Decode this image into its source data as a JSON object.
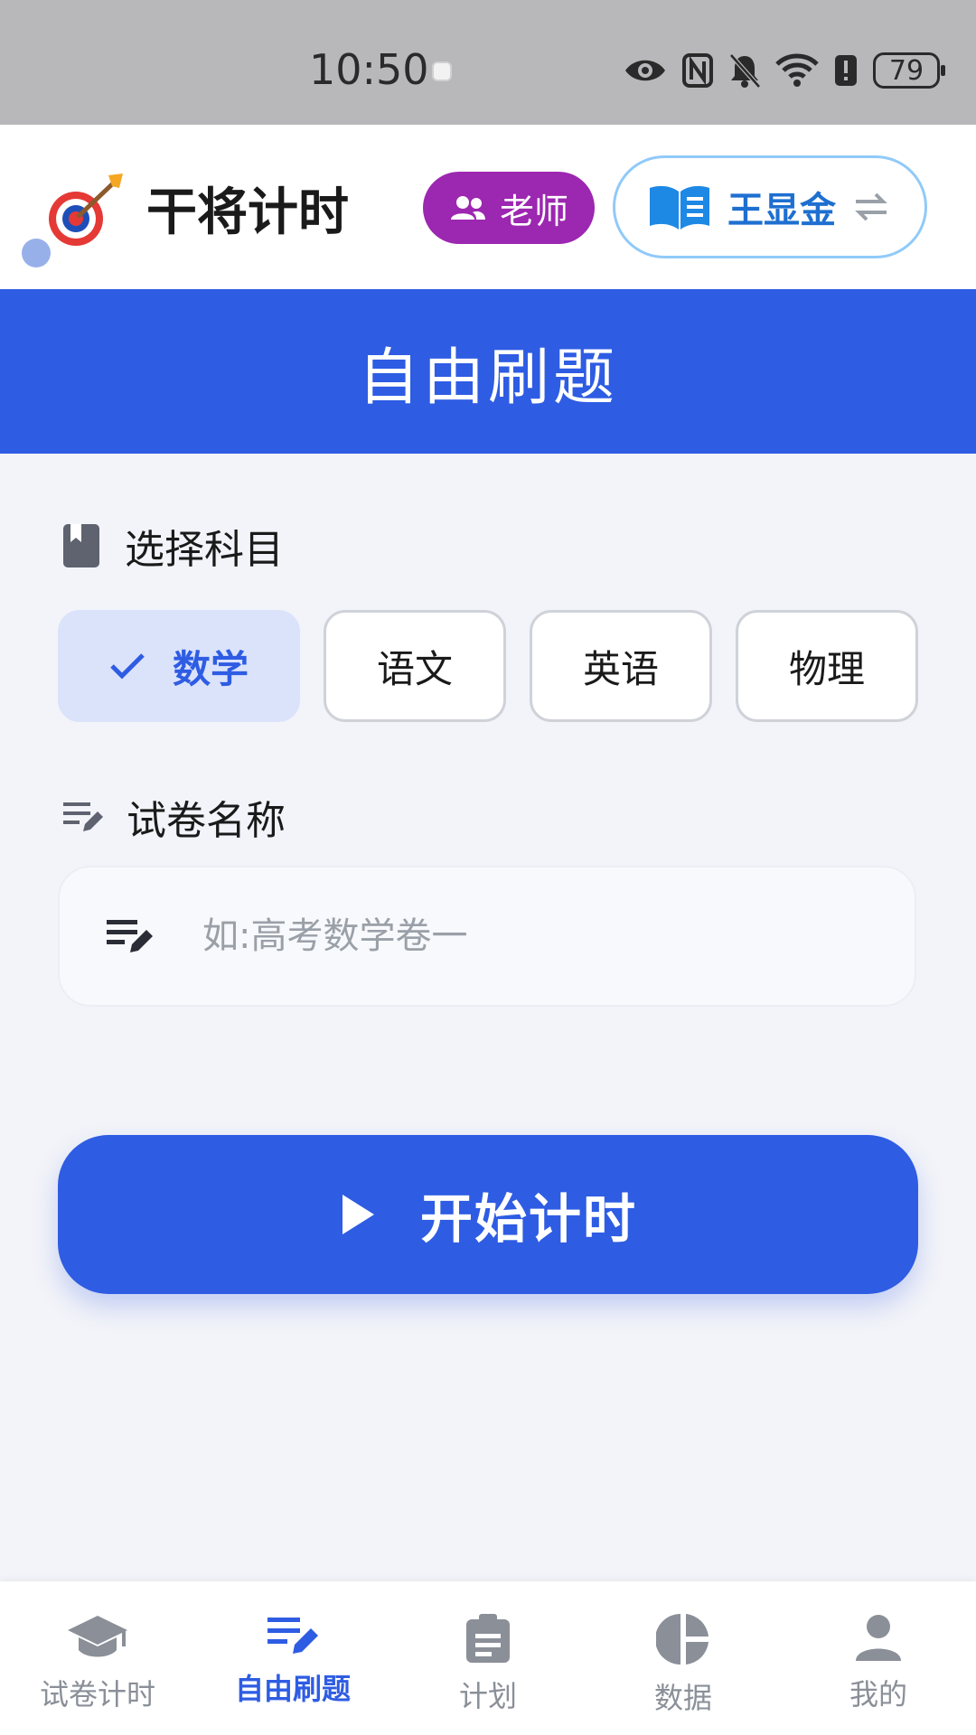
{
  "status_bar": {
    "time": "10:50",
    "battery": "79",
    "icons": [
      "eye-icon",
      "nfc-icon",
      "bell-off-icon",
      "wifi-icon",
      "battery-alert-icon"
    ]
  },
  "header": {
    "app_title": "干将计时",
    "logo": "target-arrow-icon",
    "role_badge": "老师",
    "user_name": "王显金"
  },
  "banner": {
    "title": "自由刷题"
  },
  "subject_section": {
    "label": "选择科目",
    "subjects": [
      {
        "label": "数学",
        "selected": true
      },
      {
        "label": "语文",
        "selected": false
      },
      {
        "label": "英语",
        "selected": false
      },
      {
        "label": "物理",
        "selected": false
      }
    ]
  },
  "paper_section": {
    "label": "试卷名称",
    "input_value": "",
    "input_placeholder": "如:高考数学卷一"
  },
  "start_button": {
    "label": "开始计时"
  },
  "bottom_nav": {
    "items": [
      {
        "label": "试卷计时",
        "icon": "graduation-cap-icon",
        "active": false
      },
      {
        "label": "自由刷题",
        "icon": "edit-list-icon",
        "active": true
      },
      {
        "label": "计划",
        "icon": "clipboard-icon",
        "active": false
      },
      {
        "label": "数据",
        "icon": "pie-chart-icon",
        "active": false
      },
      {
        "label": "我的",
        "icon": "person-icon",
        "active": false
      }
    ]
  },
  "colors": {
    "primary": "#2e5ce3",
    "role_badge": "#9c27b0",
    "user_accent": "#1e6fd0",
    "selected_chip_bg": "#dbe3fb",
    "inactive": "#8a8f98"
  }
}
